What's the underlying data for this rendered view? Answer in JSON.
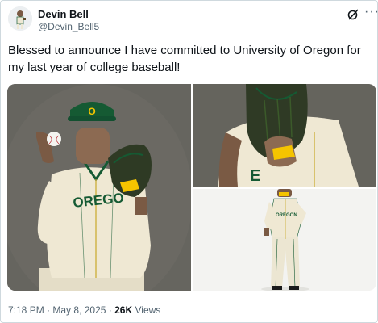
{
  "author": {
    "display_name": "Devin Bell",
    "handle": "@Devin_Bell5"
  },
  "tweet": {
    "text": "Blessed to announce I have committed to University of Oregon for my last year of college baseball!"
  },
  "media": {
    "photo_count": 3,
    "jersey_text": "OREGON",
    "colors": {
      "background": "#66655f",
      "jersey": "#efe8d3",
      "trim": "#155a33",
      "accent": "#f5c400"
    }
  },
  "meta": {
    "time": "7:18 PM",
    "separator": "·",
    "date": "May 8, 2025",
    "views_count": "26K",
    "views_label": "Views"
  },
  "icons": {
    "grok": "grok-icon",
    "more": "more-icon"
  }
}
